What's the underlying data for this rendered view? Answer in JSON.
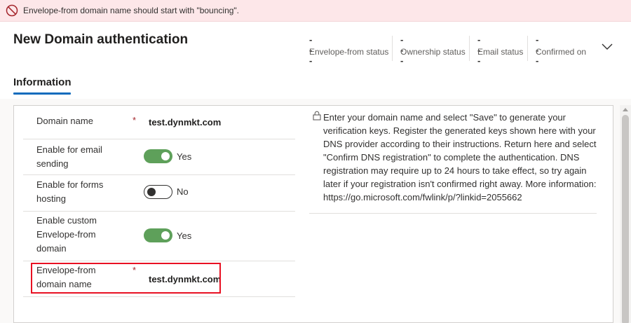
{
  "notification": {
    "message": "Envelope-from domain name should start with \"bouncing\"."
  },
  "header": {
    "title": "New Domain authentication",
    "statuses": [
      {
        "value": "---",
        "label": "Envelope-from status"
      },
      {
        "value": "---",
        "label": "Ownership status"
      },
      {
        "value": "---",
        "label": "Email status"
      },
      {
        "value": "---",
        "label": "Confirmed on"
      }
    ]
  },
  "tabs": [
    {
      "label": "Information",
      "selected": true
    }
  ],
  "form": {
    "domain_name": {
      "label": "Domain name",
      "required": "*",
      "value": "test.dynmkt.com"
    },
    "email_sending": {
      "label_line1": "Enable for email",
      "label_line2": "sending",
      "state": "Yes",
      "on": true
    },
    "forms_hosting": {
      "label_line1": "Enable for forms",
      "label_line2": "hosting",
      "state": "No",
      "on": false
    },
    "custom_envelope": {
      "label_line1": "Enable custom",
      "label_line2": "Envelope-from",
      "label_line3": "domain",
      "state": "Yes",
      "on": true
    },
    "envelope_domain": {
      "label_line1": "Envelope-from",
      "label_line2": "domain name",
      "required": "*",
      "value": "test.dynmkt.com"
    }
  },
  "info": {
    "text": "Enter your domain name and select \"Save\" to generate your verification keys. Register the generated keys shown here with your DNS provider according to their instructions. Return here and select \"Confirm DNS registration\" to complete the authentication. DNS registration may require up to 24 hours to take effect, so try again later if your registration isn't confirmed right away. More information: https://go.microsoft.com/fwlink/p/?linkid=2055662"
  },
  "colors": {
    "error_bg": "#fde7e9",
    "error_icon": "#a4262c",
    "toggle_on": "#5ea05a",
    "tab_accent": "#0f6cbd",
    "highlight": "#e81123"
  }
}
